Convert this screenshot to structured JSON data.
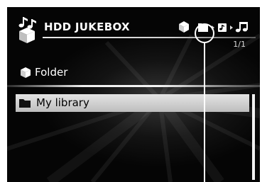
{
  "app": {
    "title": "HDD JUKEBOX",
    "logo_icon": "jukebox-notes-cube-icon"
  },
  "hierarchy": {
    "items": [
      {
        "icon": "cube-icon",
        "active": false
      },
      {
        "icon": "folder-icon",
        "active": true
      },
      {
        "icon": "album-icon",
        "active": false
      },
      {
        "icon": "music-note-icon",
        "active": false
      }
    ],
    "separator_icon": "triangle-right-icon"
  },
  "page_counter": "1/1",
  "section": {
    "icon": "cube-icon",
    "label": "Folder"
  },
  "list": {
    "items": [
      {
        "label": "My library",
        "icon": "folder-icon",
        "selected": true
      }
    ]
  },
  "colors": {
    "screen_bg": "#050505",
    "text": "#ffffff",
    "highlight": "#d4d4d4",
    "highlight_text": "#000000"
  }
}
